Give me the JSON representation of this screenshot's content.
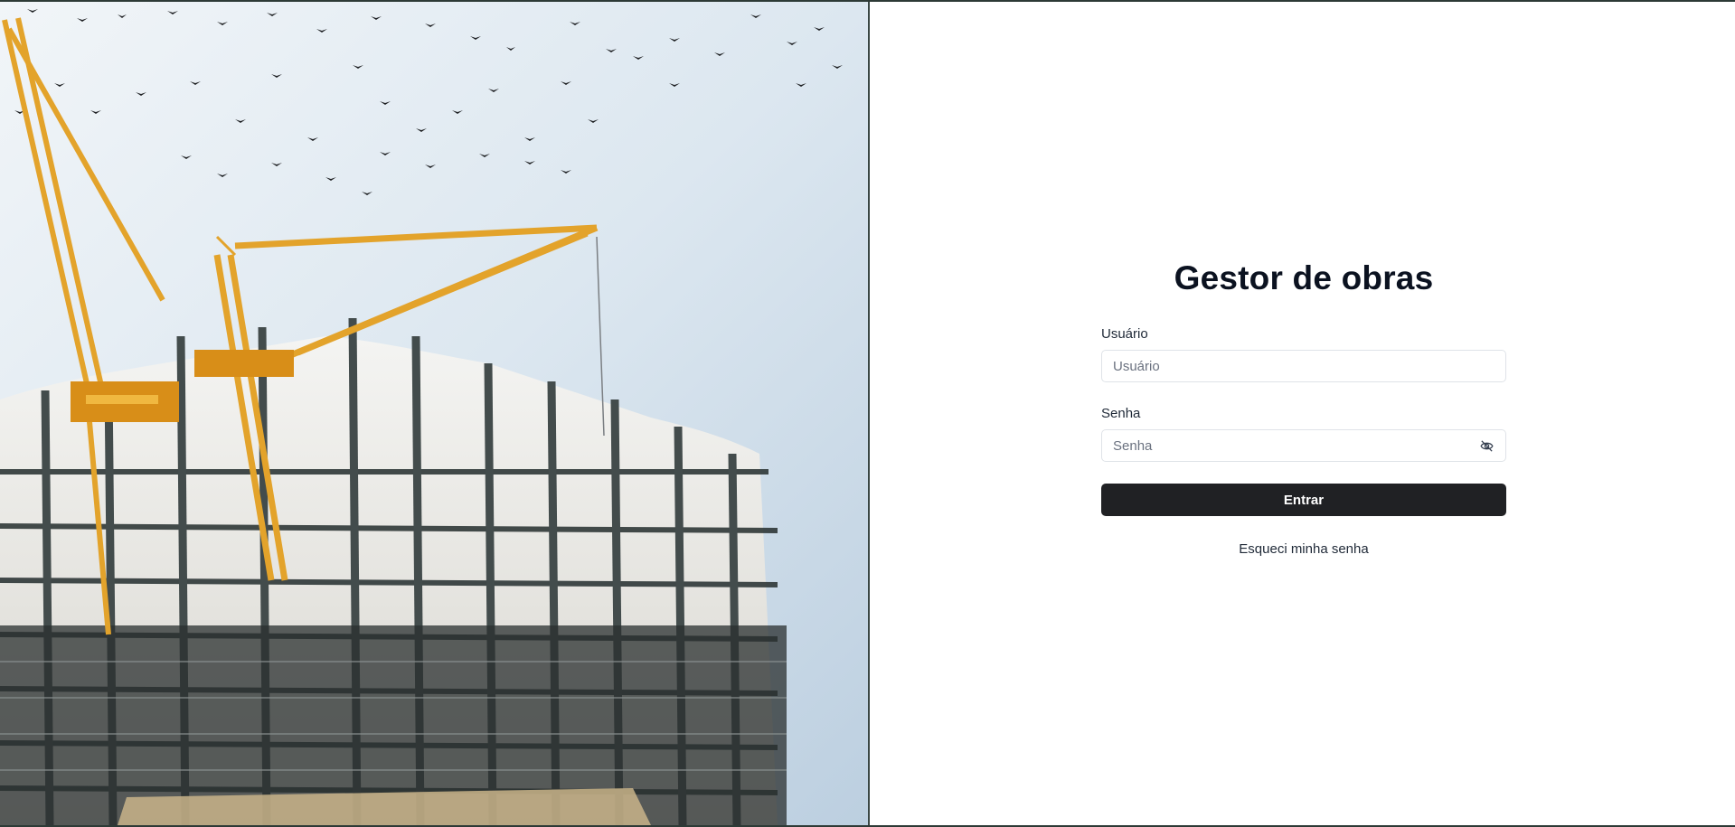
{
  "hero": {
    "image_alt": "Construction site with cranes and birds"
  },
  "login": {
    "title": "Gestor de obras",
    "username_label": "Usuário",
    "username_placeholder": "Usuário",
    "username_value": "",
    "password_label": "Senha",
    "password_placeholder": "Senha",
    "password_value": "",
    "password_toggle_icon": "eye-off-icon",
    "submit_label": "Entrar",
    "forgot_label": "Esqueci minha senha"
  },
  "colors": {
    "button_bg": "#202124",
    "title": "#0b1220",
    "input_border": "#dfe3e8",
    "crane": "#e3a32b"
  }
}
